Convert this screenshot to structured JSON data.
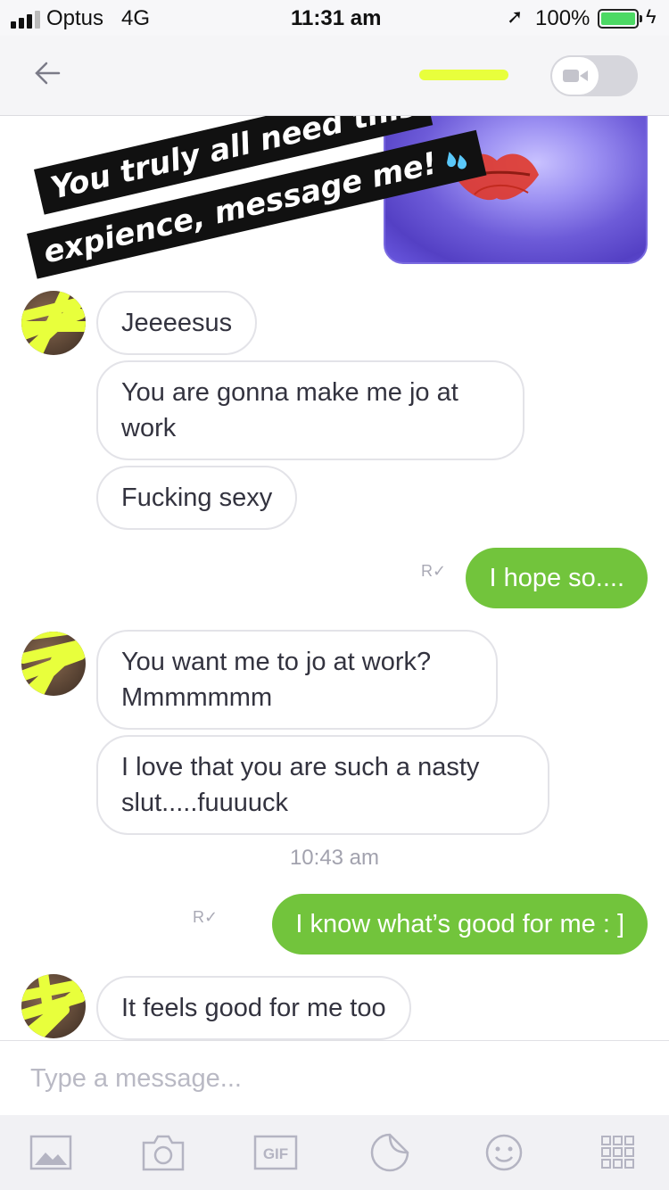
{
  "status_bar": {
    "carrier": "Optus",
    "network": "4G",
    "time": "11:31 am",
    "battery_percent": "100%"
  },
  "header": {
    "video_toggle_on": false
  },
  "overlay_banner": {
    "line1": "You truly all need this",
    "line2": "expience, message me!"
  },
  "messages": [
    {
      "from": "them",
      "text": "Jeeeesus"
    },
    {
      "from": "them",
      "text": "You are gonna make me jo at work"
    },
    {
      "from": "them",
      "text": "Fucking sexy"
    },
    {
      "from": "me",
      "text": "I hope so....",
      "receipt": "R"
    },
    {
      "from": "them",
      "text": "You want me to jo at work? Mmmmmmm"
    },
    {
      "from": "them",
      "text": "I love that you are such a nasty slut.....fuuuuck"
    },
    {
      "from": "me",
      "text": "I know what’s good for me : ]",
      "receipt": "R"
    },
    {
      "from": "them",
      "text": "It feels good for me too"
    }
  ],
  "timestamp": "10:43 am",
  "composer": {
    "placeholder": "Type a message..."
  },
  "toolbar": {
    "items": [
      "image-icon",
      "camera-icon",
      "gif-icon",
      "sticker-icon",
      "emoji-icon",
      "grid-icon"
    ],
    "gif_label": "GIF"
  },
  "colors": {
    "outgoing_bubble": "#72c43c",
    "highlight_scribble": "#e8ff3c",
    "photo_tint": "#6d5bd8"
  }
}
